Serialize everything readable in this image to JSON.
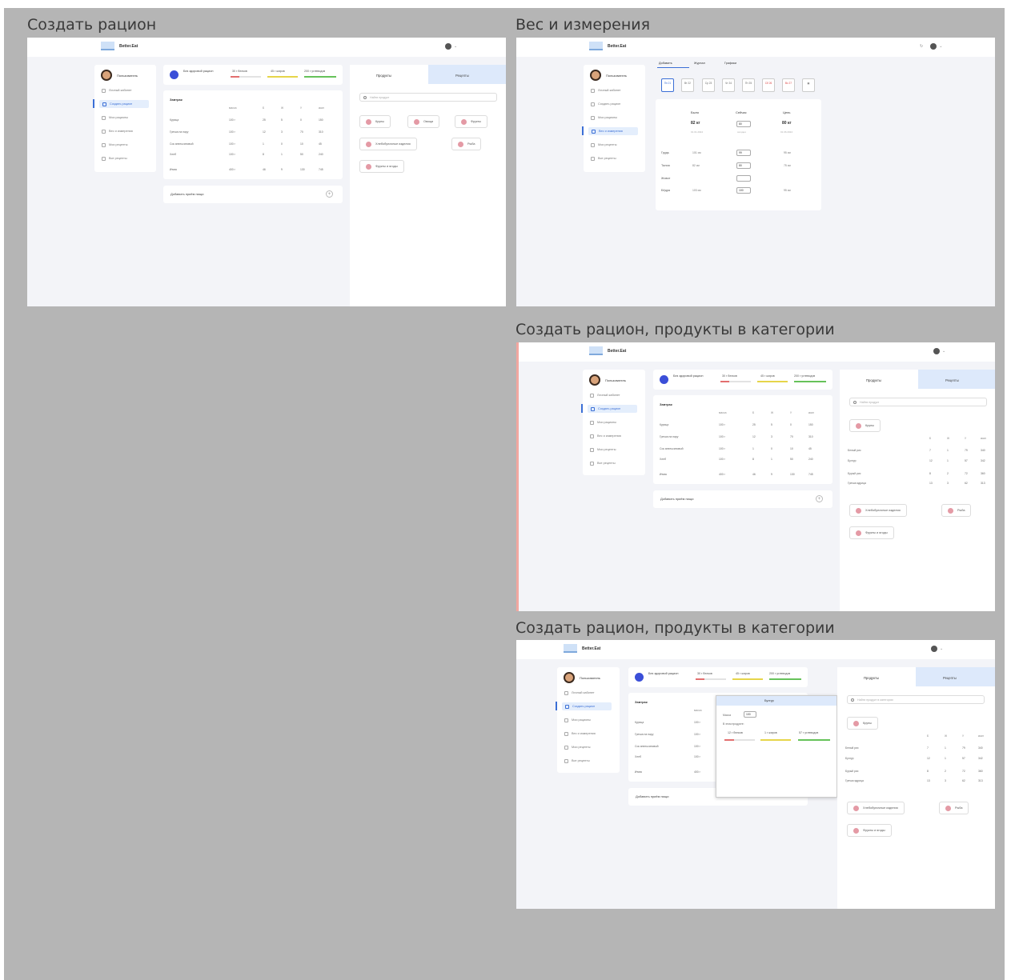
{
  "frames": {
    "diet_create": {
      "title": "Создать рацион"
    },
    "weight": {
      "title": "Вес и измерения"
    },
    "diet_category_1": {
      "title": "Создать рацион, продукты в категории"
    },
    "diet_category_2": {
      "title": "Создать рацион, продукты в категории"
    }
  },
  "app": {
    "logo_text": "Better.Eat",
    "user_name": "Пользователь",
    "colors": {
      "accent": "#3b6fd6",
      "goal": "#3b4fd8",
      "tab_bg": "#dde9fb",
      "protein": "#e36f6f",
      "fat": "#e6d54a",
      "carbs": "#66c25a"
    }
  },
  "nav": {
    "items": [
      "Личный кабинет",
      "Создать рацион",
      "Мои рационы",
      "Вес и измерения",
      "Мои рецепты",
      "Все рецепты"
    ],
    "active_index": 1
  },
  "goal": {
    "label": "Без здоровой рацион",
    "macros": [
      "30 г белков",
      "45 г жиров",
      "200 г углеводов"
    ]
  },
  "breakfast": {
    "title": "Завтрак",
    "columns": [
      "масса",
      "Б",
      "Ж",
      "У",
      "ккал"
    ],
    "rows": [
      [
        "Курица",
        "100 г",
        "25",
        "5",
        "0",
        "150"
      ],
      [
        "Гречка на пару",
        "100 г",
        "12",
        "3",
        "70",
        "310"
      ],
      [
        "Сок апельсиновый",
        "100 г",
        "1",
        "0",
        "10",
        "45"
      ],
      [
        "Хлеб",
        "100 г",
        "8",
        "1",
        "50",
        "240"
      ]
    ],
    "total": [
      "Итого",
      "400 г",
      "46",
      "9",
      "130",
      "745"
    ],
    "add_meal": "Добавить приём пищи"
  },
  "products": {
    "tab_products": "Продукты",
    "tab_recipes": "Рецепты",
    "search_placeholder": "Найти продукт",
    "search_placeholder_category": "Найти продукт в категории",
    "categories": [
      "Крупы",
      "Овощи",
      "Фрукты",
      "Хлебобулочные изделия",
      "Рыба",
      "Фрукты и ягоды"
    ],
    "open_category": "Крупы",
    "category_columns": [
      "Б",
      "Ж",
      "У",
      "ккал"
    ],
    "category_rows": [
      [
        "Белый рис",
        "7",
        "1",
        "79",
        "340"
      ],
      [
        "Булгур",
        "12",
        "1",
        "57",
        "342"
      ],
      [
        "Бурый рис",
        "8",
        "2",
        "72",
        "360"
      ],
      [
        "Гречка ядрица",
        "13",
        "3",
        "62",
        "313"
      ]
    ]
  },
  "weight": {
    "tabs": [
      "Добавить",
      "Журнал",
      "Графики"
    ],
    "days": [
      "Пн 21",
      "Вт 22",
      "Ср 23",
      "Чт 24",
      "Пт 25",
      "Сб 26",
      "Вс 27"
    ],
    "columns": [
      "Было",
      "Сейчас",
      "Цель"
    ],
    "values": [
      "82 кг",
      "80",
      "80 кг"
    ],
    "sub": [
      "01.01.2024",
      "сегодня",
      "01.06.2024"
    ],
    "rows": [
      {
        "label": "Грудь",
        "before": "101 см",
        "now": "99",
        "goal": "95 см"
      },
      {
        "label": "Талия",
        "before": "82 см",
        "now": "80",
        "goal": "75 см"
      },
      {
        "label": "Живот",
        "before": "",
        "now": "",
        "goal": ""
      },
      {
        "label": "Бёдра",
        "before": "103 см",
        "now": "100",
        "goal": "95 см"
      }
    ]
  },
  "popup": {
    "title": "Булгур",
    "mass_label": "Масса",
    "mass_value": "100",
    "sub_label": "В этом продукте:",
    "macros": [
      "12 г белков",
      "1 г жиров",
      "57 г углеводов"
    ]
  }
}
